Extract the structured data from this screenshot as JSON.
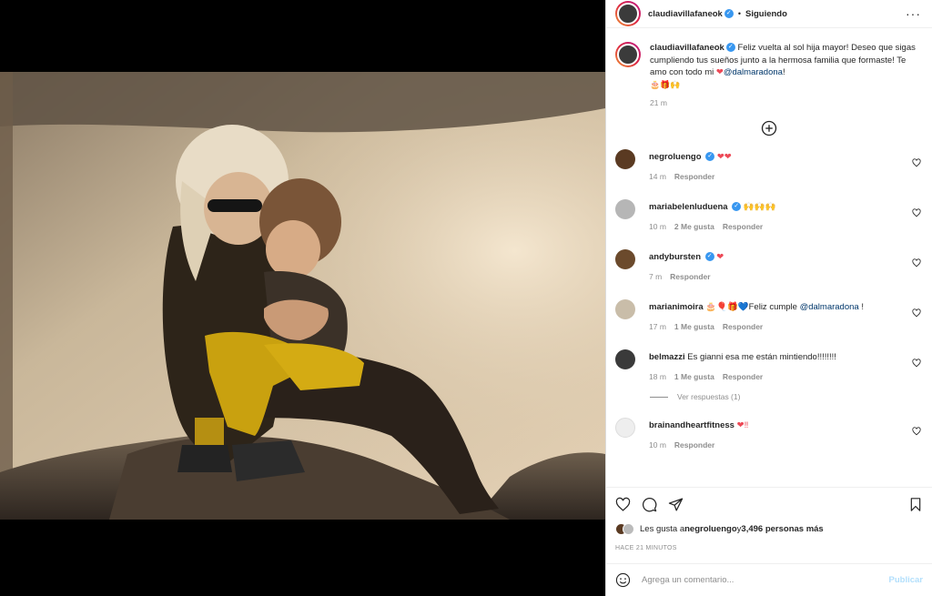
{
  "header": {
    "username": "claudiavillafaneok",
    "verified_icon": "verified-badge-icon",
    "separator": "•",
    "follow_status": "Siguiendo",
    "more": "···"
  },
  "caption": {
    "username": "claudiavillafaneok",
    "text": "Feliz vuelta al sol hija mayor! Deseo que sigas cumpliendo tus sueños junto a la hermosa familia que formaste! Te amo con todo mi ",
    "heart": "❤",
    "mention": "@dalmaradona",
    "after_mention": "!",
    "emoji_line": "🎂🎁🙌",
    "time": "21 m"
  },
  "load_more_icon": "plus-circle-icon",
  "comments": [
    {
      "username": "negroluengo",
      "verified": true,
      "text": "",
      "emoji": "❤❤",
      "time": "14 m",
      "likes": "",
      "reply": "Responder"
    },
    {
      "username": "mariabelenluduena",
      "verified": true,
      "text": "",
      "emoji": "🙌🙌🙌",
      "time": "10 m",
      "likes": "2 Me gusta",
      "reply": "Responder"
    },
    {
      "username": "andybursten",
      "verified": true,
      "text": "",
      "emoji": "❤",
      "time": "7 m",
      "likes": "",
      "reply": "Responder"
    },
    {
      "username": "marianimoira",
      "verified": false,
      "text": "🎂🎈🎁💙Feliz cumple ",
      "mention": "@dalmaradona",
      "after": " !",
      "time": "17 m",
      "likes": "1 Me gusta",
      "reply": "Responder"
    },
    {
      "username": "belmazzi",
      "verified": false,
      "text": "Es gianni esa me están mintiendo!!!!!!!!",
      "time": "18 m",
      "likes": "1 Me gusta",
      "reply": "Responder",
      "view_replies": "Ver respuestas (1)"
    },
    {
      "username": "brainandheartfitness",
      "verified": false,
      "text": "",
      "emoji": "❤‼",
      "time": "10 m",
      "likes": "",
      "reply": "Responder"
    }
  ],
  "actions": {
    "like_icon": "heart-icon",
    "comment_icon": "comment-icon",
    "share_icon": "paper-plane-icon",
    "save_icon": "bookmark-icon"
  },
  "likes": {
    "prefix": "Les gusta a ",
    "user": "negroluengo",
    "middle": " y ",
    "count": "3,496 personas más"
  },
  "posted_ago": "HACE 21 MINUTOS",
  "add_comment": {
    "placeholder": "Agrega un comentario...",
    "publish": "Publicar",
    "emoji_icon": "smiley-icon"
  },
  "colors": {
    "verified": "#3897f0",
    "link": "#00376b",
    "heart": "#ed4956",
    "publish": "#b2dffc"
  }
}
